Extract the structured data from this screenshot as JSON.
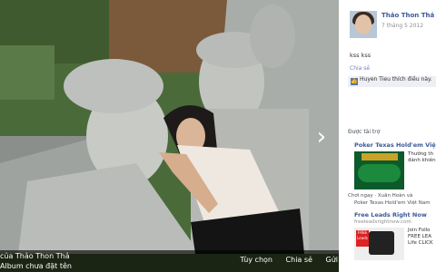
{
  "photo_viewer": {
    "caption_line1": "của Thảo Thon Thả",
    "caption_line2": "Album chưa đặt tên",
    "actions": {
      "options": "Tùy chọn",
      "share": "Chia sẻ",
      "send": "Gửi"
    },
    "next_arrow": "›"
  },
  "post": {
    "author": "Thảo Thon Thả",
    "date": "7 tháng 5 2012",
    "text": "kss kss",
    "share_link": "Chia sẻ",
    "likes": "Huyen Tieu thích điều này."
  },
  "ads": {
    "sponsored_label": "Được tài trợ",
    "ad1": {
      "title": "Poker Texas Hold'em Việt",
      "text": "Thưởng th đánh khiên",
      "social_line1": "Chơi ngay · Xuân Hoàn và",
      "social_line2": "Poker Texas Hold'em Việt Nam"
    },
    "ad2": {
      "title": "Free Leads Right Now",
      "domain": "freeleadsrightnow.com",
      "text": "Join Follo FREE LEA Life CLICK",
      "badge": "FREE Leads"
    }
  }
}
